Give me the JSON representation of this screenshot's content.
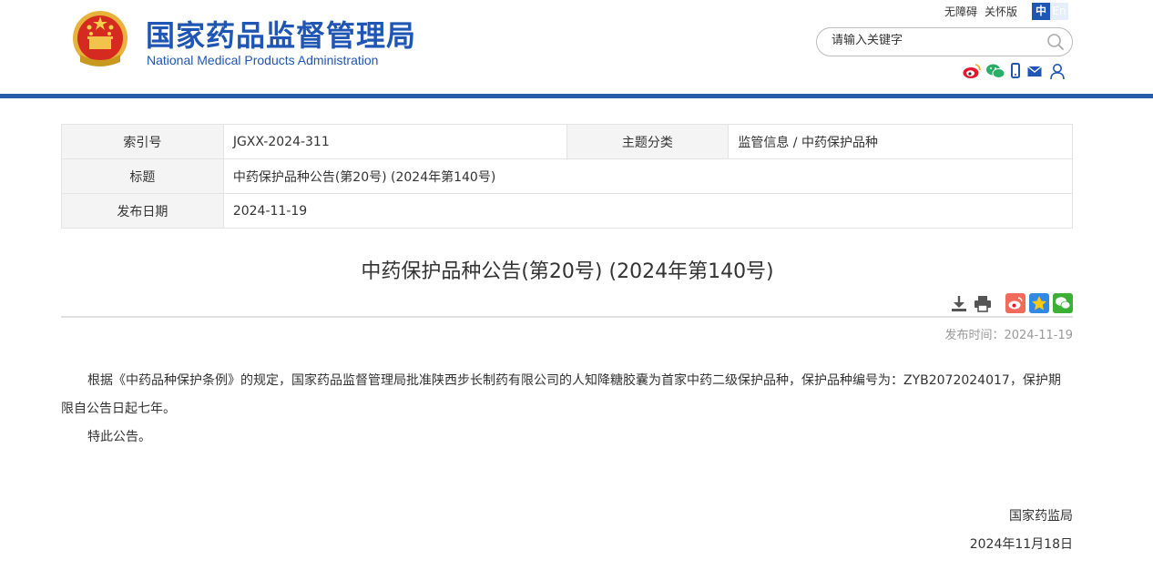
{
  "header": {
    "site_title": "国家药品监督管理局",
    "site_subtitle": "National Medical Products Administration",
    "top_links": [
      "无障碍",
      "关怀版"
    ],
    "lang_zh": "中",
    "lang_en": "En",
    "search_placeholder": "请输入关键字",
    "social_icons": [
      "weibo-icon",
      "wechat-icon",
      "mobile-icon",
      "mail-icon",
      "user-icon"
    ],
    "brand_color": "#1f56b3",
    "bar_color": "#2a5ba8"
  },
  "info": {
    "index_label": "索引号",
    "index_value": "JGXX-2024-311",
    "category_label": "主题分类",
    "category_value": "监管信息 / 中药保护品种",
    "title_label": "标题",
    "title_value": "中药保护品种公告(第20号) (2024年第140号)",
    "date_label": "发布日期",
    "date_value": "2024-11-19"
  },
  "article": {
    "title": "中药保护品种公告(第20号) (2024年第140号)",
    "tools": [
      "download-icon",
      "print-icon",
      "share-weibo-icon",
      "share-qzone-icon",
      "share-wechat-icon"
    ],
    "pubtime": "发布时间：2024-11-19",
    "paragraph1": "根据《中药品种保护条例》的规定，国家药品监督管理局批准陕西步长制药有限公司的人知降糖胶囊为首家中药二级保护品种，保护品种编号为：ZYB2072024017，保护期限自公告日起七年。",
    "paragraph2": "特此公告。",
    "signature_org": "国家药监局",
    "signature_date": "2024年11月18日"
  }
}
